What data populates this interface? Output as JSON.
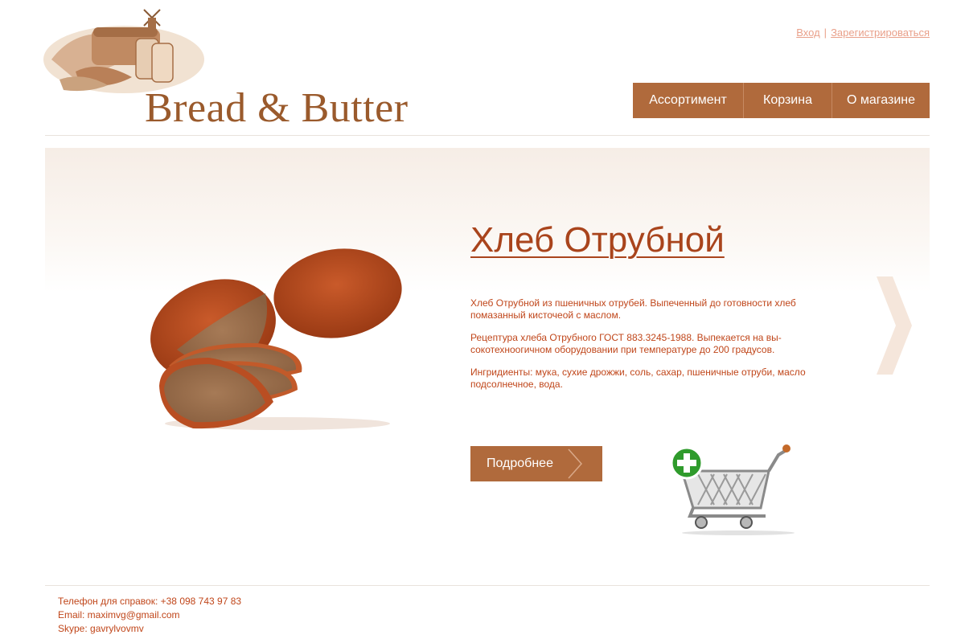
{
  "brand": {
    "name": "Bread & Butter",
    "logo_icon": "bakery-windmill-logo-icon"
  },
  "auth": {
    "login": "Вход",
    "separator": "|",
    "register": "Зарегистрироваться"
  },
  "nav": {
    "items": [
      {
        "label": "Ассортимент"
      },
      {
        "label": "Корзина"
      },
      {
        "label": "О магазине"
      }
    ]
  },
  "product": {
    "title": "Хлеб Отрубной",
    "description": [
      "Хлеб Отрубной из пшеничных отрубей. Выпеченный до готовности хлеб помазанный кисточеой с маслом.",
      "Рецептура хлеба Отрубного ГОСТ 883.3245-1988. Выпекается на вы-сокотехноогичном оборудовании при температуре до 200 градусов.",
      "Ингридиенты: мука, сухие дрожжи, соль, сахар, пшеничные отруби, масло подсолнечное, вода."
    ],
    "more_button": "Подробнее",
    "image_icon": "bran-bread-image",
    "cart_icon": "add-to-cart-icon",
    "next_icon": "chevron-right-icon"
  },
  "footer": {
    "phone": "Телефон для справок: +38 098 743 97 83",
    "email": "Email: maximvg@gmail.com",
    "skype": "Skype: gavrylvovmv"
  },
  "colors": {
    "accent": "#b06a3c",
    "text": "#c0461a",
    "title": "#a9441c",
    "link": "#e9a08a",
    "logo_text": "#9a5a2c"
  }
}
